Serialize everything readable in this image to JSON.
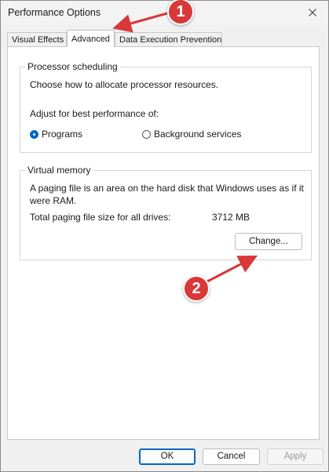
{
  "window": {
    "title": "Performance Options",
    "close_glyph": "✕"
  },
  "tabs": [
    {
      "label": "Visual Effects",
      "active": false
    },
    {
      "label": "Advanced",
      "active": true
    },
    {
      "label": "Data Execution Prevention",
      "active": false
    }
  ],
  "processor": {
    "legend": "Processor scheduling",
    "description": "Choose how to allocate processor resources.",
    "adjust_label": "Adjust for best performance of:",
    "options": [
      {
        "label": "Programs",
        "checked": true
      },
      {
        "label": "Background services",
        "checked": false
      }
    ]
  },
  "virtual_memory": {
    "legend": "Virtual memory",
    "description": "A paging file is an area on the hard disk that Windows uses as if it were RAM.",
    "total_label": "Total paging file size for all drives:",
    "total_value": "3712 MB",
    "change_button": "Change..."
  },
  "footer": {
    "ok": "OK",
    "cancel": "Cancel",
    "apply": "Apply"
  },
  "annotations": {
    "badge_1": "1",
    "badge_2": "2",
    "color": "#d8383a"
  }
}
